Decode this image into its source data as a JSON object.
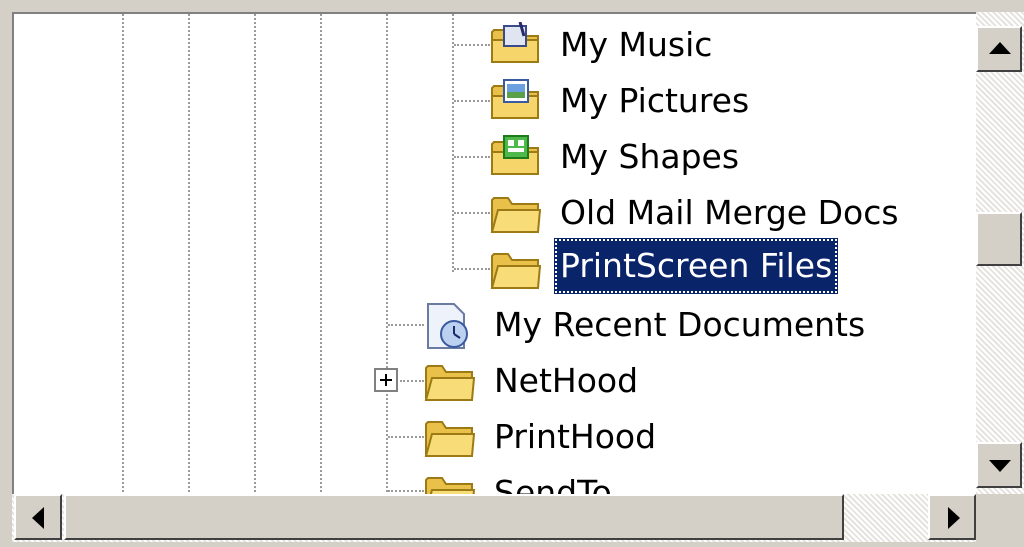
{
  "tree": {
    "items": [
      {
        "label": "My Music",
        "icon": "music-folder-icon"
      },
      {
        "label": "My Pictures",
        "icon": "pictures-folder-icon"
      },
      {
        "label": "My Shapes",
        "icon": "shapes-folder-icon"
      },
      {
        "label": "Old Mail Merge Docs",
        "icon": "folder-icon"
      },
      {
        "label": "PrintScreen Files",
        "icon": "folder-icon",
        "selected": true
      },
      {
        "label": "My Recent Documents",
        "icon": "recent-documents-icon"
      },
      {
        "label": "NetHood",
        "icon": "folder-icon",
        "expandable": true
      },
      {
        "label": "PrintHood",
        "icon": "folder-icon"
      },
      {
        "label": "SendTo",
        "icon": "folder-icon"
      }
    ]
  },
  "colors": {
    "selection": "#0a246a",
    "folder": "#f6d56a",
    "window_bg": "#d4d0c8"
  }
}
